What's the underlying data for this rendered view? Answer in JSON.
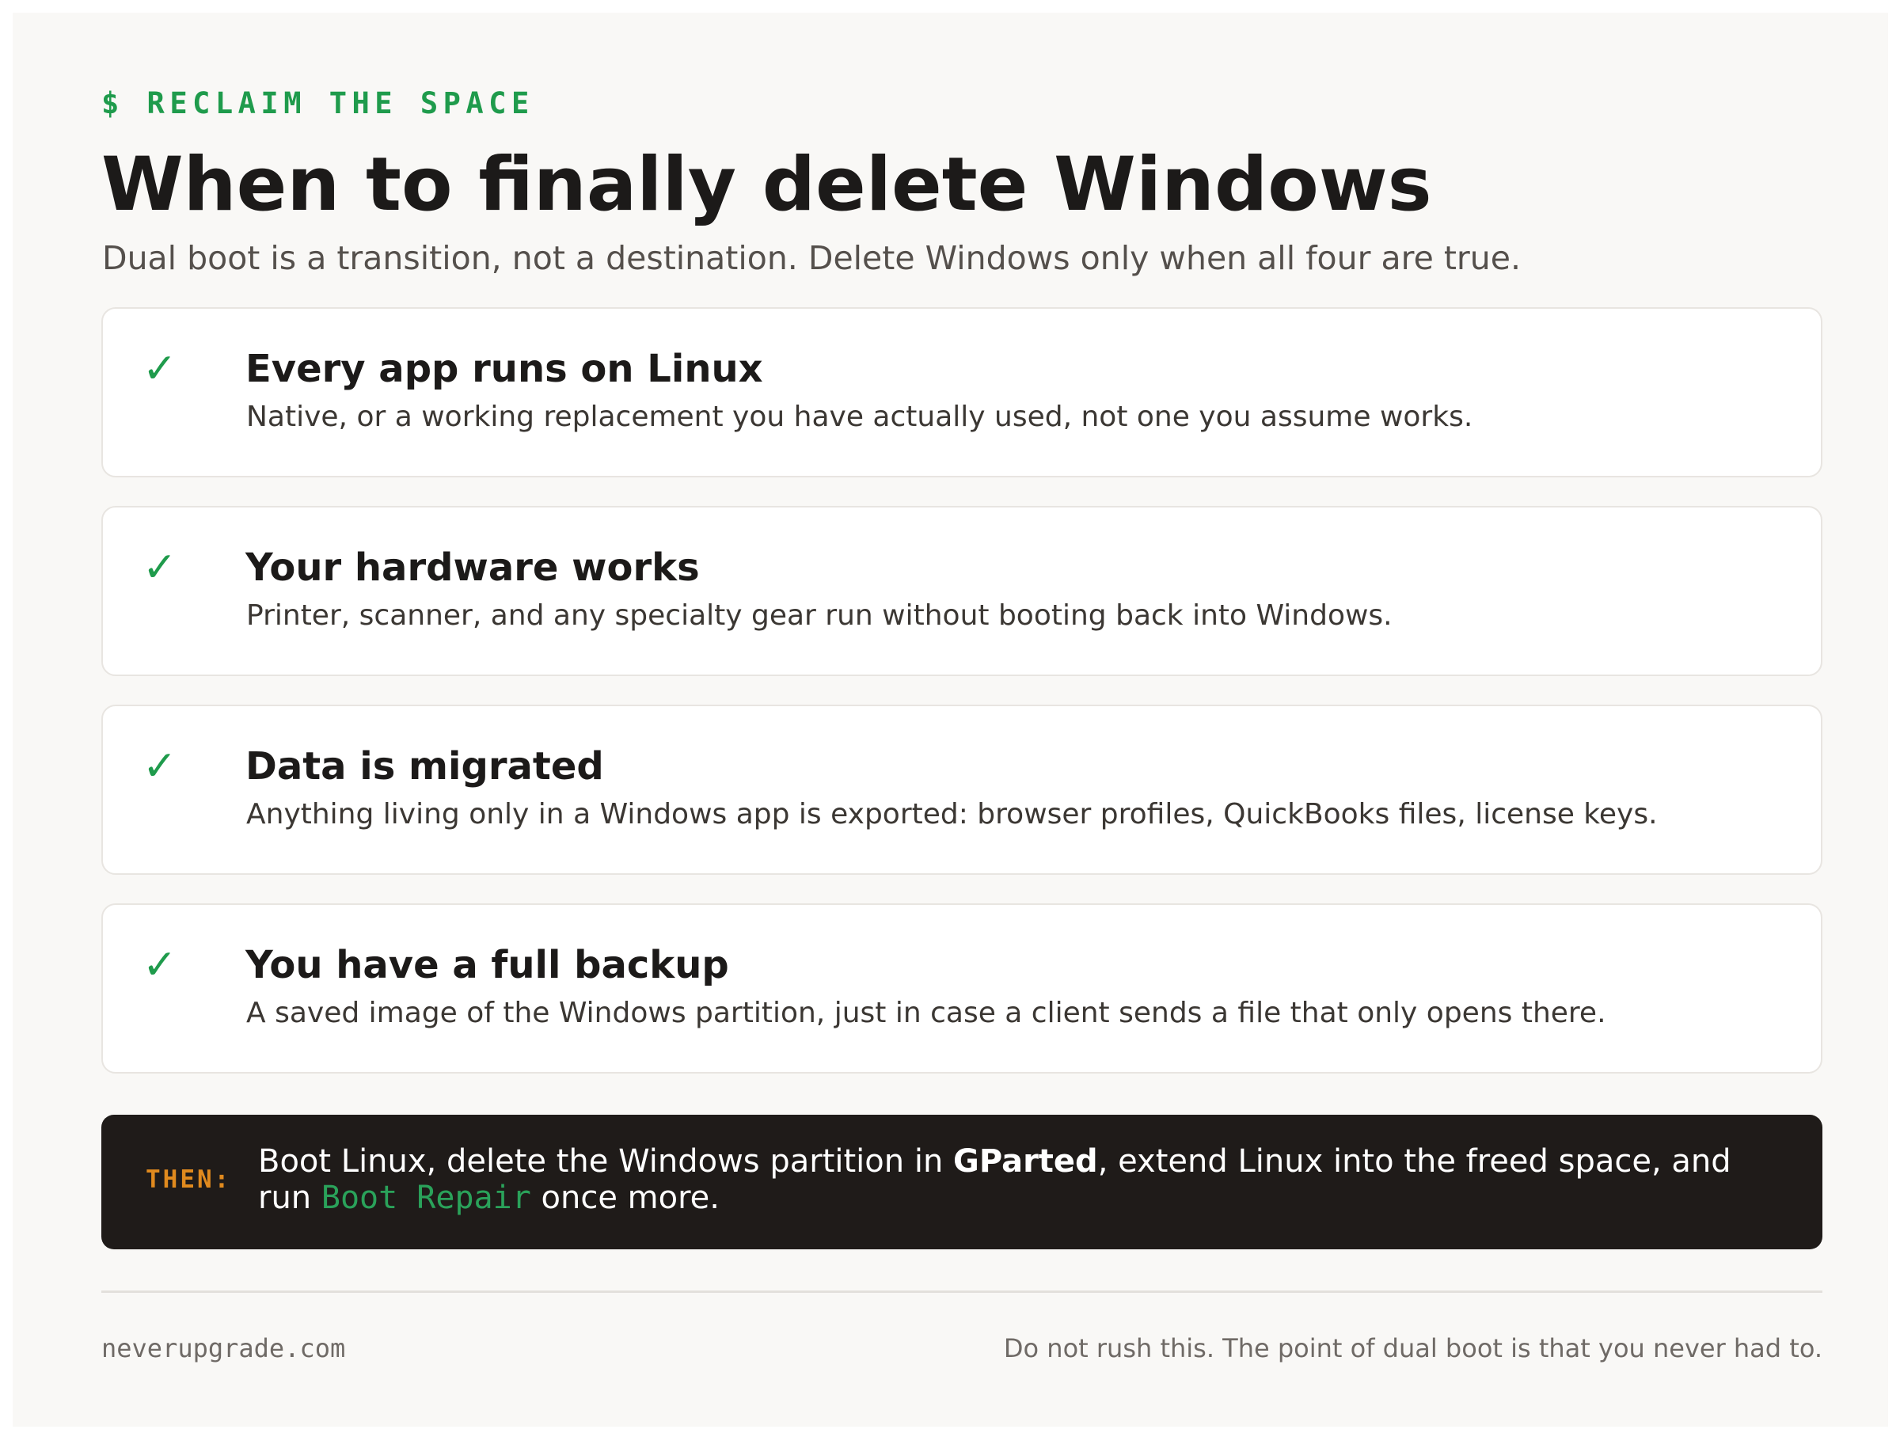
{
  "eyebrow": "$ RECLAIM THE SPACE",
  "title": "When to finally delete Windows",
  "subtitle": "Dual boot is a transition, not a destination. Delete Windows only when all four are true.",
  "criteria": [
    {
      "icon": "check-icon",
      "check": "✓",
      "title": "Every app runs on Linux",
      "desc": "Native, or a working replacement you have actually used, not one you assume works."
    },
    {
      "icon": "check-icon",
      "check": "✓",
      "title": "Your hardware works",
      "desc": "Printer, scanner, and any specialty gear run without booting back into Windows."
    },
    {
      "icon": "check-icon",
      "check": "✓",
      "title": "Data is migrated",
      "desc": "Anything living only in a Windows app is exported: browser profiles, QuickBooks files, license keys."
    },
    {
      "icon": "check-icon",
      "check": "✓",
      "title": "You have a full backup",
      "desc": "A saved image of the Windows partition, just in case a client sends a file that only opens there."
    }
  ],
  "then": {
    "label": "THEN:",
    "part1": "Boot Linux, delete the Windows partition in ",
    "highlight": "GParted",
    "part2": ", extend Linux into the freed space, and run ",
    "command": "Boot Repair",
    "part3": " once more."
  },
  "footer": {
    "site": "neverupgrade.com",
    "note": "Do not rush this. The point of dual boot is that you never had to."
  },
  "colors": {
    "accent_green": "#1f9b4c",
    "accent_orange": "#e08a1e",
    "dark_box": "#1f1b19",
    "page_bg": "#f9f8f6"
  }
}
